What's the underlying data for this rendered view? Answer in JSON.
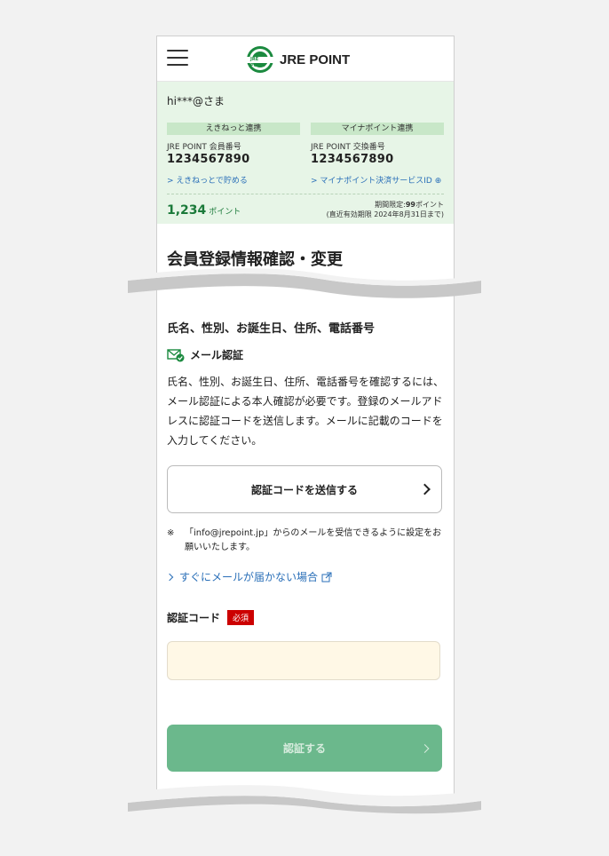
{
  "header": {
    "logo_mark_text": "JRE POINT",
    "logo_text": "JRE POINT"
  },
  "account": {
    "user": "hi***@さま",
    "left": {
      "head": "えきねっと連携",
      "label": "JRE POINT 会員番号",
      "number": "1234567890",
      "link": "えきねっとで貯める"
    },
    "right": {
      "head": "マイナポイント連携",
      "label": "JRE POINT 交換番号",
      "number": "1234567890",
      "link": "マイナポイント決済サービスID"
    },
    "points": "1,234",
    "points_unit": "ポイント",
    "limit_prefix": "期間限定:",
    "limit_value": "99",
    "limit_suffix": "ポイント",
    "limit_expiry": "(直近有効期限 2024年8月31日まで)"
  },
  "page_title": "会員登録情報確認・変更",
  "section_title": "氏名、性別、お誕生日、住所、電話番号",
  "mail_auth_label": "メール認証",
  "paragraph": "氏名、性別、お誕生日、住所、電話番号を確認するには、メール認証による本人確認が必要です。登録のメールアドレスに認証コードを送信します。メールに記載のコードを入力してください。",
  "send_button": "認証コードを送信する",
  "note_mark": "※",
  "note_text": "「info@jrepoint.jp」からのメールを受信できるように設定をお願いいたします。",
  "help_link": "すぐにメールが届かない場合",
  "code_label": "認証コード",
  "required_badge": "必須",
  "code_input": {
    "value": "",
    "placeholder": ""
  },
  "submit_button": "認証する",
  "colors": {
    "brand_green": "#1b8a3f",
    "account_bg": "#e7f5e7",
    "link_blue": "#2a6fb8",
    "required_red": "#cc0000",
    "submit_green": "#6bb88c",
    "input_bg": "#fff8e6"
  }
}
